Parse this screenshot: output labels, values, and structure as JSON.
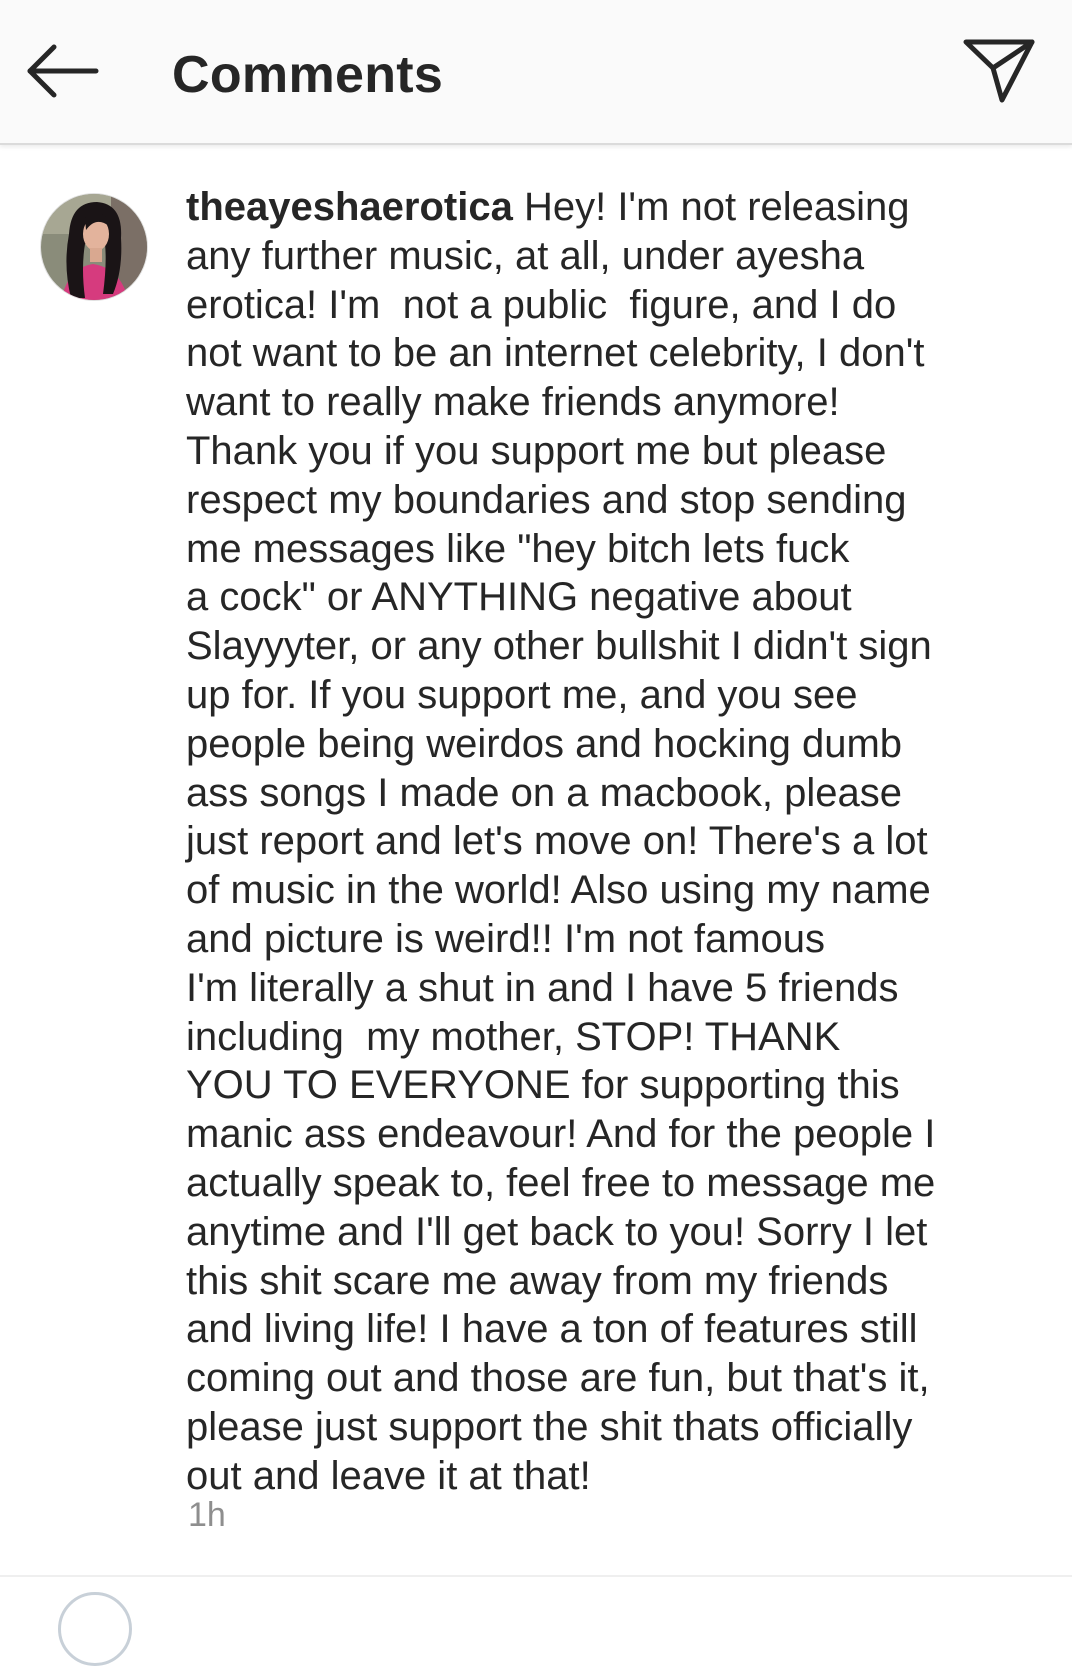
{
  "header": {
    "title": "Comments",
    "back_icon": "arrow-left-icon",
    "share_icon": "direct-send-icon"
  },
  "comment": {
    "username": "theayeshaerotica",
    "lines": [
      " Hey! I'm not releasing",
      "any further music, at all, under ayesha",
      "erotica! I'm  not a public  figure, and I do",
      "not want to be an internet celebrity, I don't",
      "want to really make friends anymore!",
      "Thank you if you support me but please",
      "respect my boundaries and stop sending",
      "me messages like \"hey bitch lets fuck",
      "a cock\" or ANYTHING negative about",
      "Slayyyter, or any other bullshit I didn't sign",
      "up for. If you support me, and you see",
      "people being weirdos and hocking dumb",
      "ass songs I made on a macbook, please",
      "just report and let's move on! There's a lot",
      "of music in the world! Also using my name",
      "and picture is weird!! I'm not famous",
      "I'm literally a shut in and I have 5 friends",
      "including  my mother, STOP! THANK",
      "YOU TO EVERYONE for supporting this",
      "manic ass endeavour! And for the people I",
      "actually speak to, feel free to message me",
      "anytime and I'll get back to you! Sorry I let",
      "this shit scare me away from my friends",
      "and living life! I have a ton of features still",
      "coming out and those are fun, but that's it,",
      "please just support the shit thats officially",
      "out and leave it at that!"
    ],
    "timestamp": "1h"
  },
  "colors": {
    "header_bg": "#fafafa",
    "text": "#262626",
    "muted": "#8e8e8e",
    "divider": "#efefef"
  }
}
